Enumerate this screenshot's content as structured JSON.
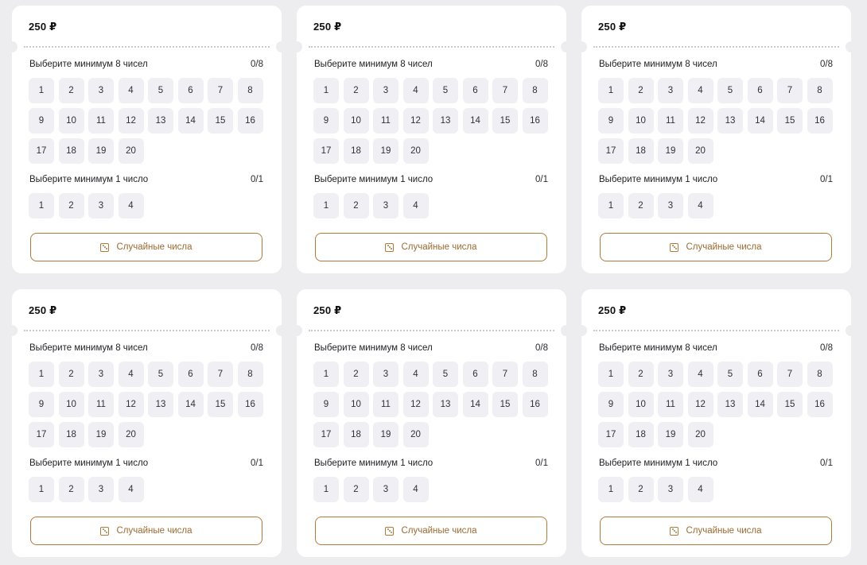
{
  "colors": {
    "page_background": "#ededf0",
    "card_background": "#ffffff",
    "number_cell": "#f0f0f4",
    "accent": "#b07a3c"
  },
  "tickets": [
    {
      "price": "250 ₽",
      "main_section": {
        "label": "Выберите минимум 8 чисел",
        "counter": "0/8",
        "numbers": [
          "1",
          "2",
          "3",
          "4",
          "5",
          "6",
          "7",
          "8",
          "9",
          "10",
          "11",
          "12",
          "13",
          "14",
          "15",
          "16",
          "17",
          "18",
          "19",
          "20"
        ]
      },
      "bonus_section": {
        "label": "Выберите минимум 1 число",
        "counter": "0/1",
        "numbers": [
          "1",
          "2",
          "3",
          "4"
        ]
      },
      "random_button": {
        "label": "Случайные числа",
        "icon": "dice-icon"
      }
    },
    {
      "price": "250 ₽",
      "main_section": {
        "label": "Выберите минимум 8 чисел",
        "counter": "0/8",
        "numbers": [
          "1",
          "2",
          "3",
          "4",
          "5",
          "6",
          "7",
          "8",
          "9",
          "10",
          "11",
          "12",
          "13",
          "14",
          "15",
          "16",
          "17",
          "18",
          "19",
          "20"
        ]
      },
      "bonus_section": {
        "label": "Выберите минимум 1 число",
        "counter": "0/1",
        "numbers": [
          "1",
          "2",
          "3",
          "4"
        ]
      },
      "random_button": {
        "label": "Случайные числа",
        "icon": "dice-icon"
      }
    },
    {
      "price": "250 ₽",
      "main_section": {
        "label": "Выберите минимум 8 чисел",
        "counter": "0/8",
        "numbers": [
          "1",
          "2",
          "3",
          "4",
          "5",
          "6",
          "7",
          "8",
          "9",
          "10",
          "11",
          "12",
          "13",
          "14",
          "15",
          "16",
          "17",
          "18",
          "19",
          "20"
        ]
      },
      "bonus_section": {
        "label": "Выберите минимум 1 число",
        "counter": "0/1",
        "numbers": [
          "1",
          "2",
          "3",
          "4"
        ]
      },
      "random_button": {
        "label": "Случайные числа",
        "icon": "dice-icon"
      }
    },
    {
      "price": "250 ₽",
      "main_section": {
        "label": "Выберите минимум 8 чисел",
        "counter": "0/8",
        "numbers": [
          "1",
          "2",
          "3",
          "4",
          "5",
          "6",
          "7",
          "8",
          "9",
          "10",
          "11",
          "12",
          "13",
          "14",
          "15",
          "16",
          "17",
          "18",
          "19",
          "20"
        ]
      },
      "bonus_section": {
        "label": "Выберите минимум 1 число",
        "counter": "0/1",
        "numbers": [
          "1",
          "2",
          "3",
          "4"
        ]
      },
      "random_button": {
        "label": "Случайные числа",
        "icon": "dice-icon"
      }
    },
    {
      "price": "250 ₽",
      "main_section": {
        "label": "Выберите минимум 8 чисел",
        "counter": "0/8",
        "numbers": [
          "1",
          "2",
          "3",
          "4",
          "5",
          "6",
          "7",
          "8",
          "9",
          "10",
          "11",
          "12",
          "13",
          "14",
          "15",
          "16",
          "17",
          "18",
          "19",
          "20"
        ]
      },
      "bonus_section": {
        "label": "Выберите минимум 1 число",
        "counter": "0/1",
        "numbers": [
          "1",
          "2",
          "3",
          "4"
        ]
      },
      "random_button": {
        "label": "Случайные числа",
        "icon": "dice-icon"
      }
    },
    {
      "price": "250 ₽",
      "main_section": {
        "label": "Выберите минимум 8 чисел",
        "counter": "0/8",
        "numbers": [
          "1",
          "2",
          "3",
          "4",
          "5",
          "6",
          "7",
          "8",
          "9",
          "10",
          "11",
          "12",
          "13",
          "14",
          "15",
          "16",
          "17",
          "18",
          "19",
          "20"
        ]
      },
      "bonus_section": {
        "label": "Выберите минимум 1 число",
        "counter": "0/1",
        "numbers": [
          "1",
          "2",
          "3",
          "4"
        ]
      },
      "random_button": {
        "label": "Случайные числа",
        "icon": "dice-icon"
      }
    }
  ]
}
